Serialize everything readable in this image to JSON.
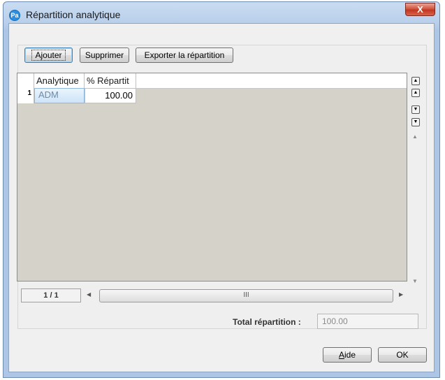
{
  "window": {
    "title": "Répartition analytique",
    "app_icon_text": "Pa",
    "close_label": "X"
  },
  "toolbar": {
    "add_label": "Ajouter",
    "delete_label": "Supprimer",
    "export_label": "Exporter la répartition"
  },
  "grid": {
    "columns": [
      "Analytique",
      "% Répartit"
    ],
    "rows": [
      {
        "num": "1",
        "analytique": "ADM",
        "pct": "100.00"
      }
    ],
    "pager": "1 / 1",
    "hscroll_thumb": "III"
  },
  "side_controls": {
    "first": "▲",
    "prev": "▲",
    "next": "▼",
    "last": "▼"
  },
  "total": {
    "label": "Total répartition :",
    "value": "100.00"
  },
  "footer": {
    "help_label": "ide",
    "help_mnemonic": "A",
    "ok_label": "OK"
  }
}
